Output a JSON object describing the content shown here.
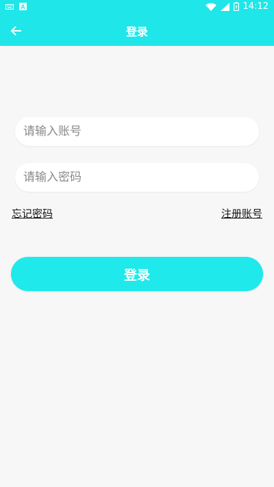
{
  "status_bar": {
    "time": "14:12",
    "left_icons": [
      "keyboard-icon",
      "font-icon"
    ],
    "right_icons": [
      "wifi-icon",
      "signal-icon",
      "battery-icon"
    ]
  },
  "app_bar": {
    "title": "登录",
    "back_icon": "arrow-left-icon",
    "color": "#1fe6e8"
  },
  "form": {
    "account_placeholder": "请输入账号",
    "password_placeholder": "请输入密码",
    "forgot_password": "忘记密码",
    "register": "注册账号",
    "login_button": "登录",
    "button_color": "#1fe9ea"
  }
}
